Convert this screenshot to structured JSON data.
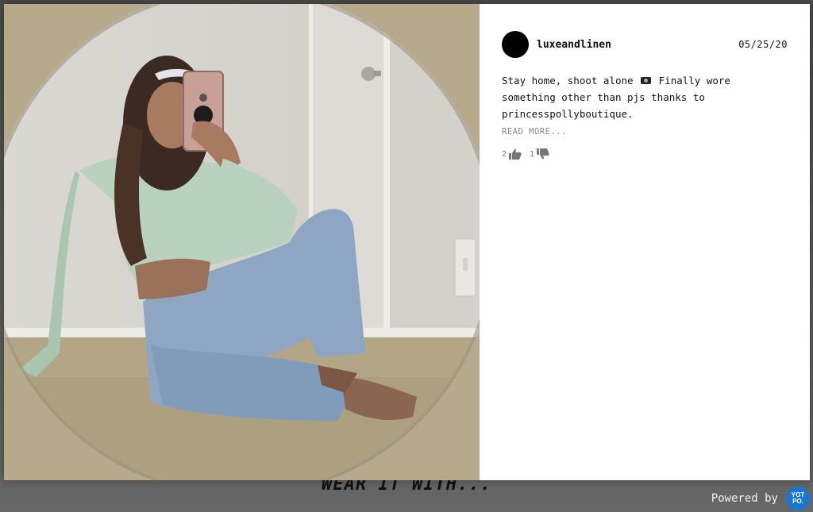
{
  "backdrop": {
    "heading": "WEAR IT WITH..."
  },
  "footer": {
    "powered_by": "Powered by",
    "brand_badge_line1": "YOT",
    "brand_badge_line2": "PO."
  },
  "post": {
    "username": "luxeandlinen",
    "date": "05/25/20",
    "caption_before_icon": "Stay home, shoot alone",
    "caption_icon": "camera-icon",
    "caption_after_icon": "Finally wore something other than pjs thanks to princesspollyboutique.",
    "read_more": "READ MORE...",
    "upvotes": "2",
    "downvotes": "1"
  },
  "colors": {
    "overlay": "#5e5e5e",
    "badge": "#1776d1",
    "avatar": "#000000"
  }
}
